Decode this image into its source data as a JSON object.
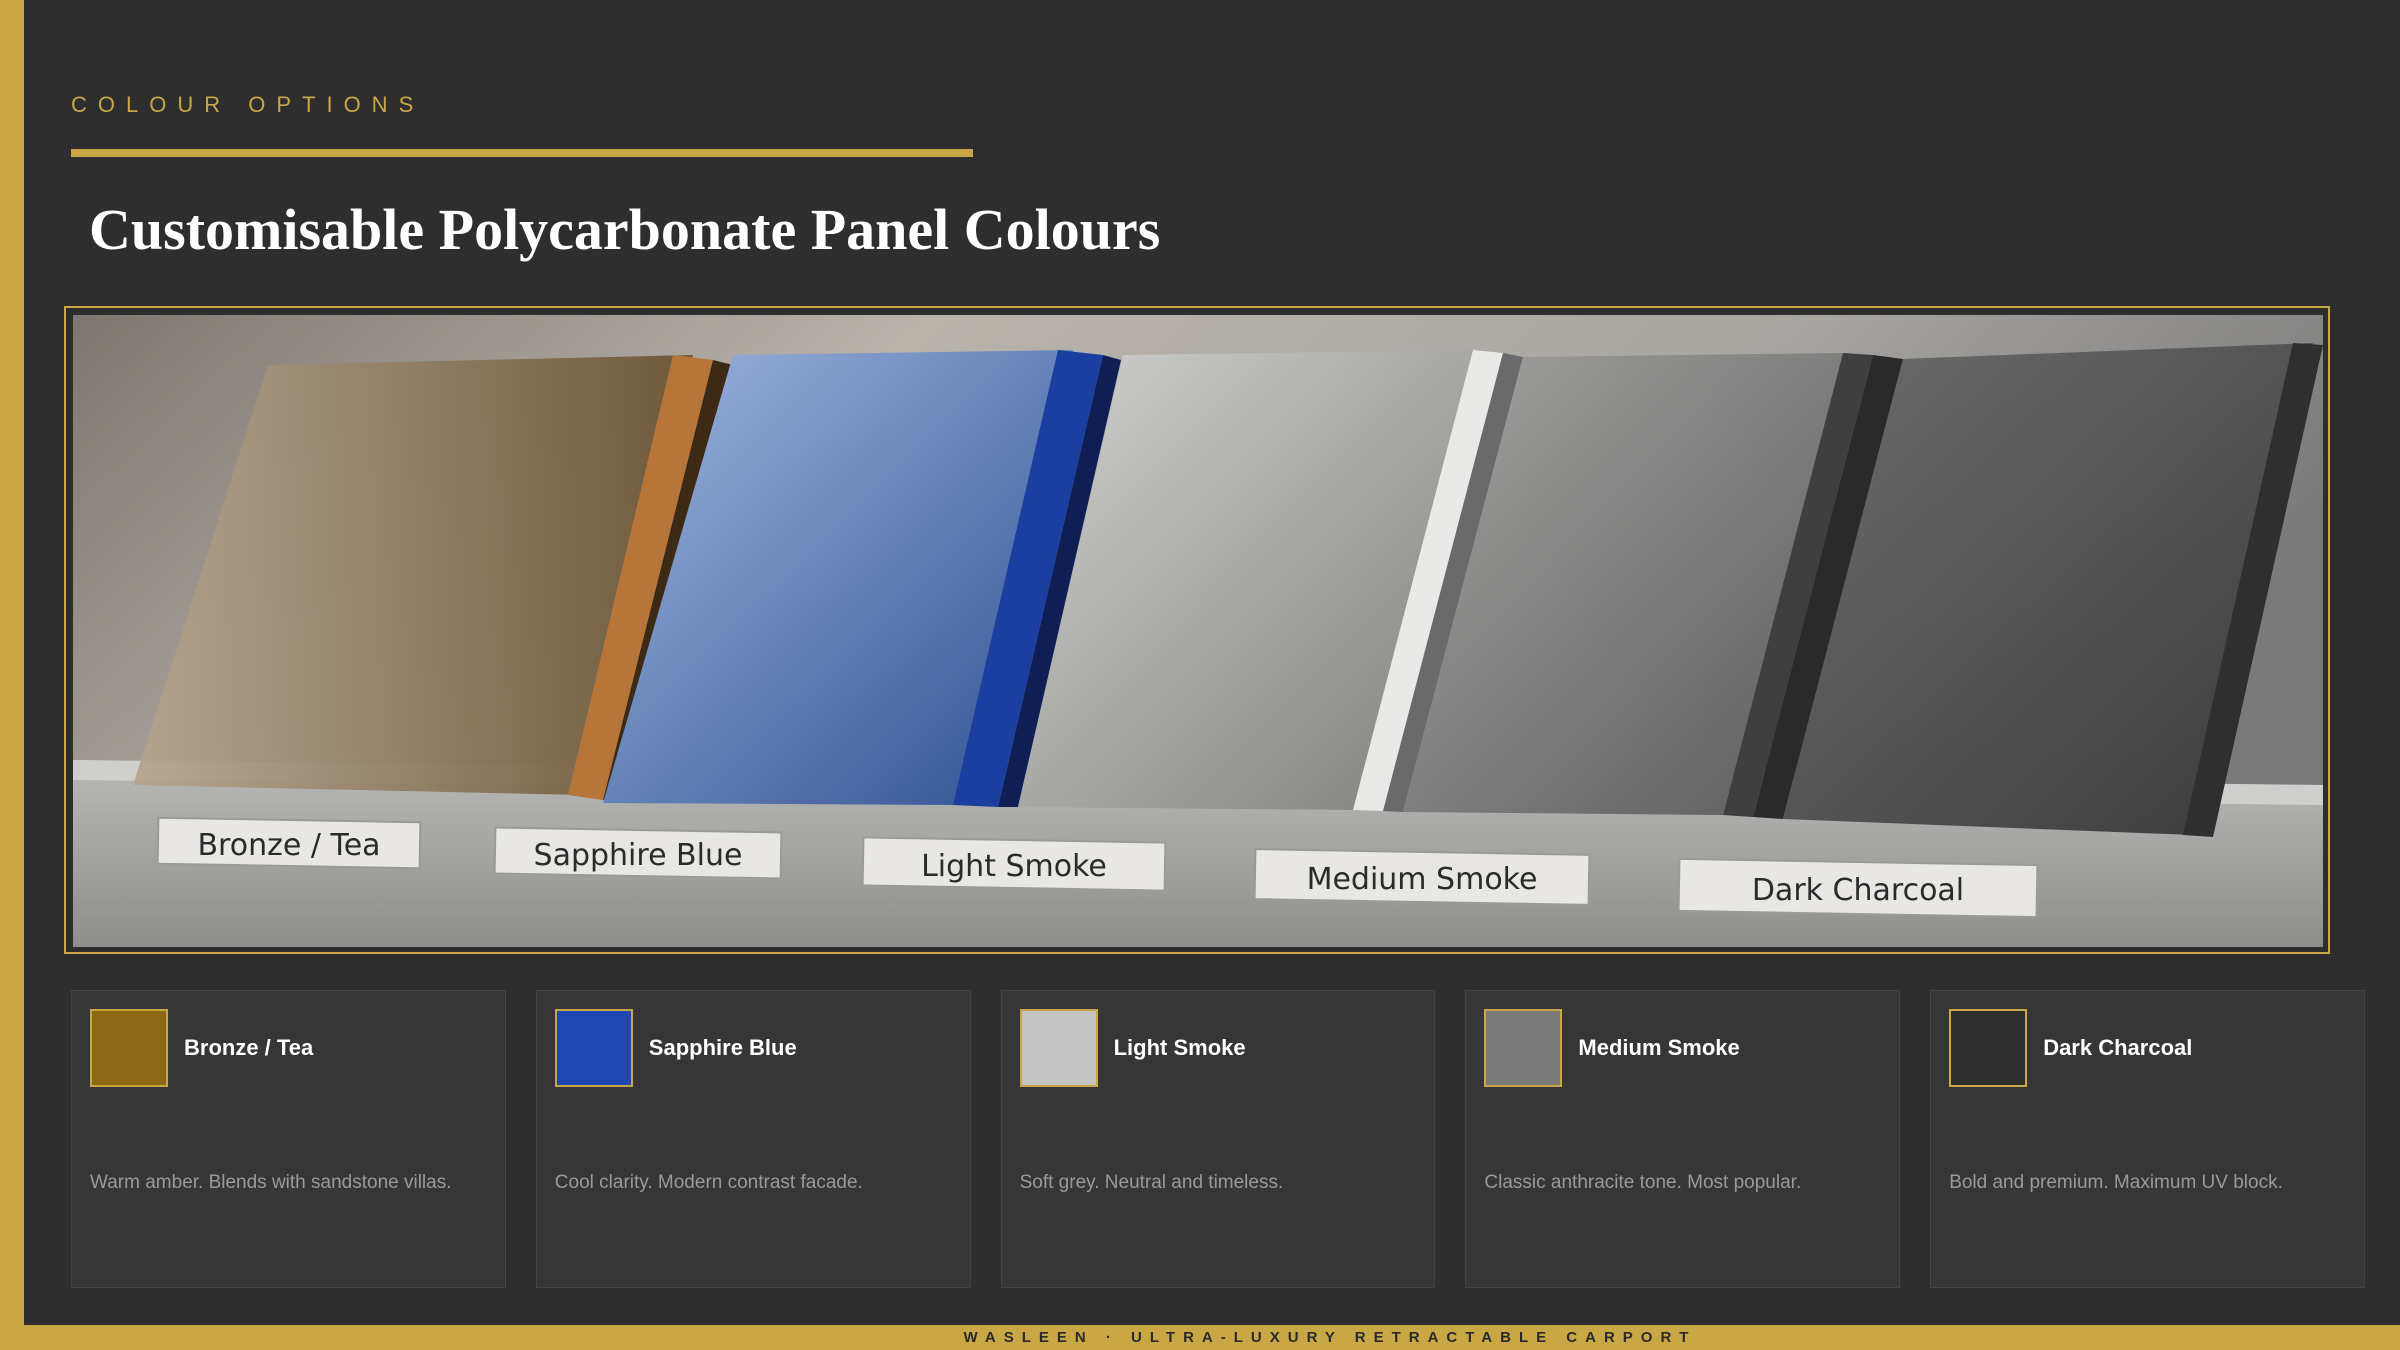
{
  "header": {
    "eyebrow": "COLOUR OPTIONS",
    "title": "Customisable Polycarbonate Panel Colours"
  },
  "photo": {
    "plaques": [
      "Bronze / Tea",
      "Sapphire Blue",
      "Light Smoke",
      "Medium Smoke",
      "Dark Charcoal"
    ]
  },
  "options": [
    {
      "name": "Bronze / Tea",
      "swatch": "#8b6914",
      "description": "Warm amber. Blends with sandstone villas."
    },
    {
      "name": "Sapphire Blue",
      "swatch": "#1e47b0",
      "description": "Cool clarity. Modern contrast facade."
    },
    {
      "name": "Light Smoke",
      "swatch": "#c4c4c4",
      "description": "Soft grey. Neutral and timeless."
    },
    {
      "name": "Medium Smoke",
      "swatch": "#7a7a7a",
      "description": "Classic anthracite tone. Most popular."
    },
    {
      "name": "Dark Charcoal",
      "swatch": "#2f2f2f",
      "description": "Bold and premium. Maximum UV block."
    }
  ],
  "footer": {
    "text": "WASLEEN  ·  ULTRA-LUXURY RETRACTABLE CARPORT"
  },
  "colors": {
    "accent_gold": "#c9a745",
    "background": "#2e2e2e",
    "card_background": "#363636"
  }
}
